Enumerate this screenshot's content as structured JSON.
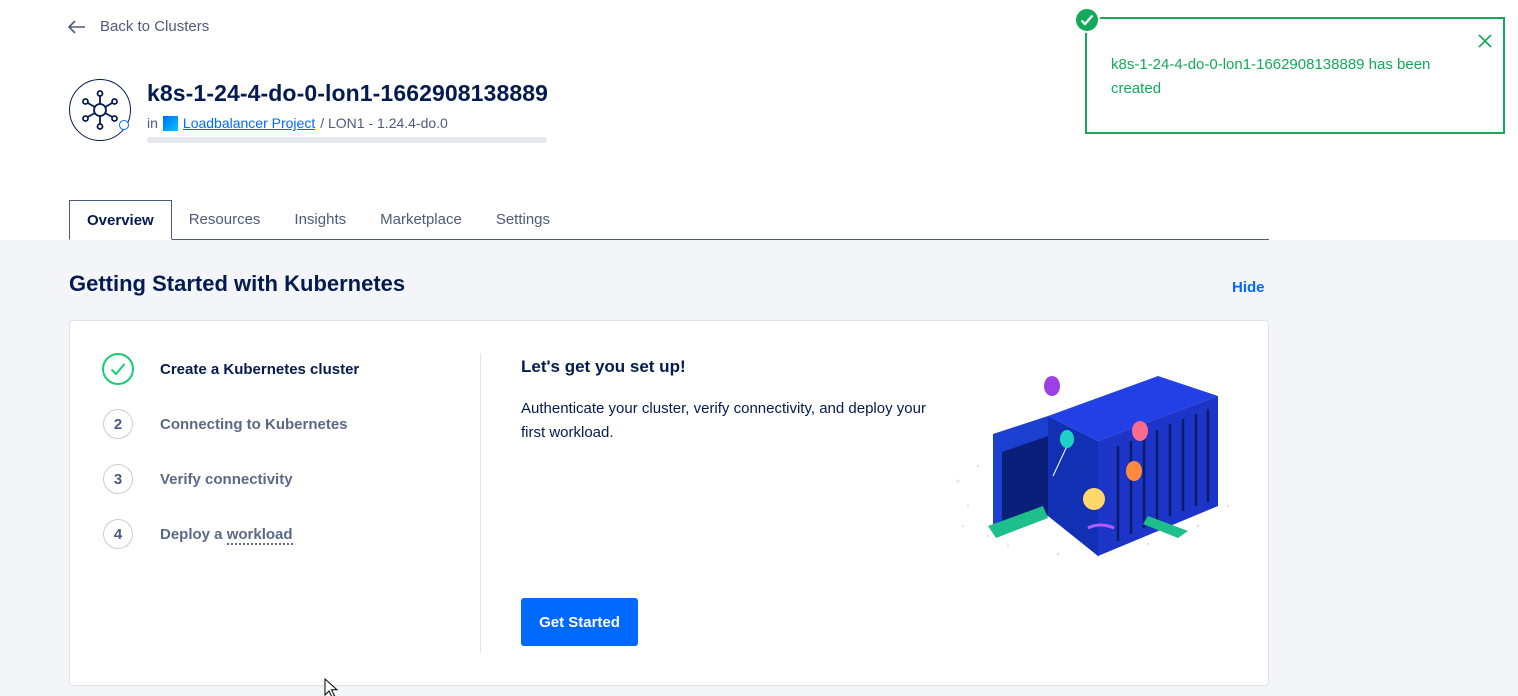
{
  "nav": {
    "back_label": "Back to Clusters"
  },
  "cluster": {
    "name": "k8s-1-24-4-do-0-lon1-1662908138889",
    "in_label": "in",
    "project_name": "Loadbalancer Project",
    "region_version": "/ LON1 - 1.24.4-do.0"
  },
  "tabs": [
    {
      "label": "Overview",
      "active": true
    },
    {
      "label": "Resources",
      "active": false
    },
    {
      "label": "Insights",
      "active": false
    },
    {
      "label": "Marketplace",
      "active": false
    },
    {
      "label": "Settings",
      "active": false
    }
  ],
  "getting_started": {
    "title": "Getting Started with Kubernetes",
    "hide_label": "Hide",
    "steps": [
      {
        "number": "",
        "label": "Create a Kubernetes cluster",
        "status": "done"
      },
      {
        "number": "2",
        "label": "Connecting to Kubernetes",
        "status": "pending"
      },
      {
        "number": "3",
        "label": "Verify connectivity",
        "status": "pending"
      },
      {
        "number": "4",
        "label_prefix": "Deploy a ",
        "label_term": "workload",
        "status": "pending"
      }
    ],
    "setup_title": "Let's get you set up!",
    "setup_desc": "Authenticate your cluster, verify connectivity, and deploy your first workload.",
    "cta_label": "Get Started"
  },
  "toast": {
    "message": "k8s-1-24-4-do-0-lon1-1662908138889 has been created",
    "type": "success"
  },
  "colors": {
    "brand_blue": "#0069ff",
    "navy": "#031b4e",
    "success_green": "#15a95a",
    "page_gray": "#f3f5f9"
  },
  "icons": {
    "back": "arrow-left-icon",
    "cluster": "kubernetes-cluster-icon",
    "project": "project-icon",
    "step_done": "check-circle-icon",
    "toast_status": "check-circle-icon",
    "toast_close": "close-icon"
  }
}
